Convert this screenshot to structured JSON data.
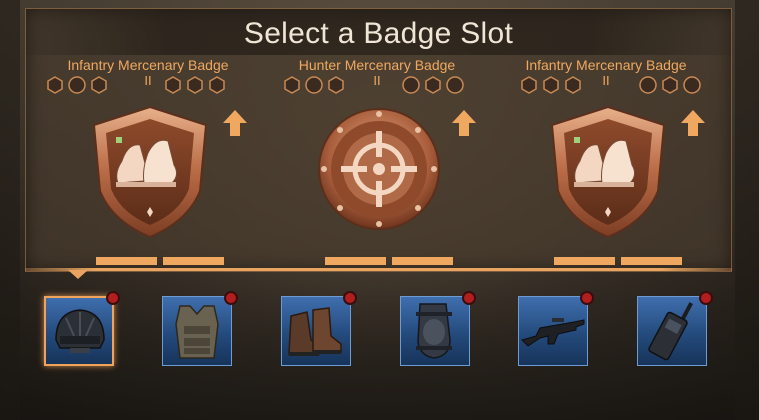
{
  "title": "Select a Badge Slot",
  "slots": [
    {
      "name": "Infantry Mercenary Badge",
      "tier": "II",
      "badge_icon": "boots-shield-badge-icon"
    },
    {
      "name": "Hunter Mercenary Badge",
      "tier": "II",
      "badge_icon": "crosshair-round-badge-icon"
    },
    {
      "name": "Infantry Mercenary Badge",
      "tier": "II",
      "badge_icon": "boots-shield-badge-icon"
    }
  ],
  "equipment": [
    {
      "icon": "helmet-icon",
      "selected": true,
      "sockets": [
        "hexagon",
        "circle",
        "hexagon"
      ]
    },
    {
      "icon": "body-armor-icon",
      "selected": false,
      "sockets": [
        "hexagon",
        "hexagon",
        "hexagon"
      ]
    },
    {
      "icon": "boots-icon",
      "selected": false,
      "sockets": [
        "hexagon",
        "circle",
        "hexagon"
      ]
    },
    {
      "icon": "knee-pad-icon",
      "selected": false,
      "sockets": [
        "circle",
        "hexagon",
        "circle"
      ]
    },
    {
      "icon": "rifle-icon",
      "selected": false,
      "sockets": [
        "hexagon",
        "hexagon",
        "hexagon"
      ]
    },
    {
      "icon": "walkie-talkie-icon",
      "selected": false,
      "sockets": [
        "circle",
        "hexagon",
        "circle"
      ]
    }
  ],
  "colors": {
    "accent": "#f0a860",
    "title": "#f1e6d6",
    "equip_blue": "#2d5a93",
    "alert_red": "#b01e1e"
  }
}
